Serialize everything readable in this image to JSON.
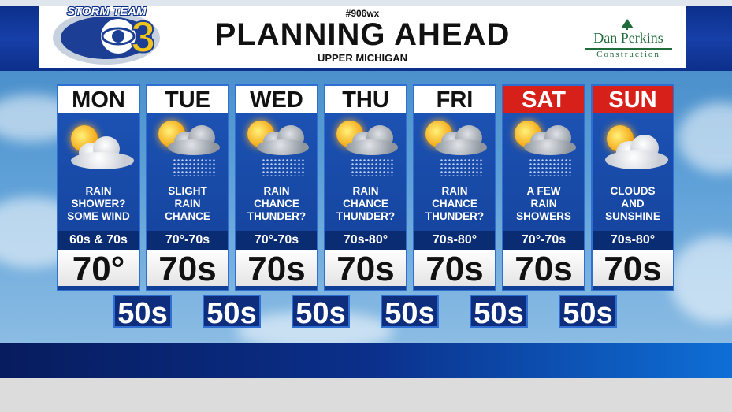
{
  "header": {
    "hashtag": "#906wx",
    "title": "PLANNING AHEAD",
    "subtitle": "UPPER MICHIGAN",
    "logo": {
      "brand": "STORM TEAM",
      "number": "3"
    },
    "sponsor": {
      "name": "Dan Perkins",
      "sub": "Construction"
    }
  },
  "forecast": [
    {
      "day": "MON",
      "weekend": false,
      "icon": "sun-cloud-wind-icon",
      "cond1": "RAIN",
      "cond2": "SHOWER?",
      "cond3": "SOME WIND",
      "range": "60s & 70s",
      "high": "70°"
    },
    {
      "day": "TUE",
      "weekend": false,
      "icon": "sun-cloud-rain-icon",
      "cond1": "SLIGHT",
      "cond2": "RAIN",
      "cond3": "CHANCE",
      "range": "70°-70s",
      "high": "70s"
    },
    {
      "day": "WED",
      "weekend": false,
      "icon": "sun-cloud-rain-icon",
      "cond1": "RAIN",
      "cond2": "CHANCE",
      "cond3": "THUNDER?",
      "range": "70°-70s",
      "high": "70s"
    },
    {
      "day": "THU",
      "weekend": false,
      "icon": "sun-cloud-rain-icon",
      "cond1": "RAIN",
      "cond2": "CHANCE",
      "cond3": "THUNDER?",
      "range": "70s-80°",
      "high": "70s"
    },
    {
      "day": "FRI",
      "weekend": false,
      "icon": "sun-cloud-rain-icon",
      "cond1": "RAIN",
      "cond2": "CHANCE",
      "cond3": "THUNDER?",
      "range": "70s-80°",
      "high": "70s"
    },
    {
      "day": "SAT",
      "weekend": true,
      "icon": "sun-cloud-rain-icon",
      "cond1": "A FEW",
      "cond2": "RAIN",
      "cond3": "SHOWERS",
      "range": "70°-70s",
      "high": "70s"
    },
    {
      "day": "SUN",
      "weekend": true,
      "icon": "sun-cloud-icon",
      "cond1": "CLOUDS",
      "cond2": "AND",
      "cond3": "SUNSHINE",
      "range": "70s-80°",
      "high": "70s"
    }
  ],
  "lows": [
    "50s",
    "50s",
    "50s",
    "50s",
    "50s",
    "50s"
  ],
  "colors": {
    "weekend_header": "#d8201a",
    "panel": "#1e55b8",
    "brand_blue": "#0b2f8a",
    "sponsor_green": "#1f6b3a"
  }
}
